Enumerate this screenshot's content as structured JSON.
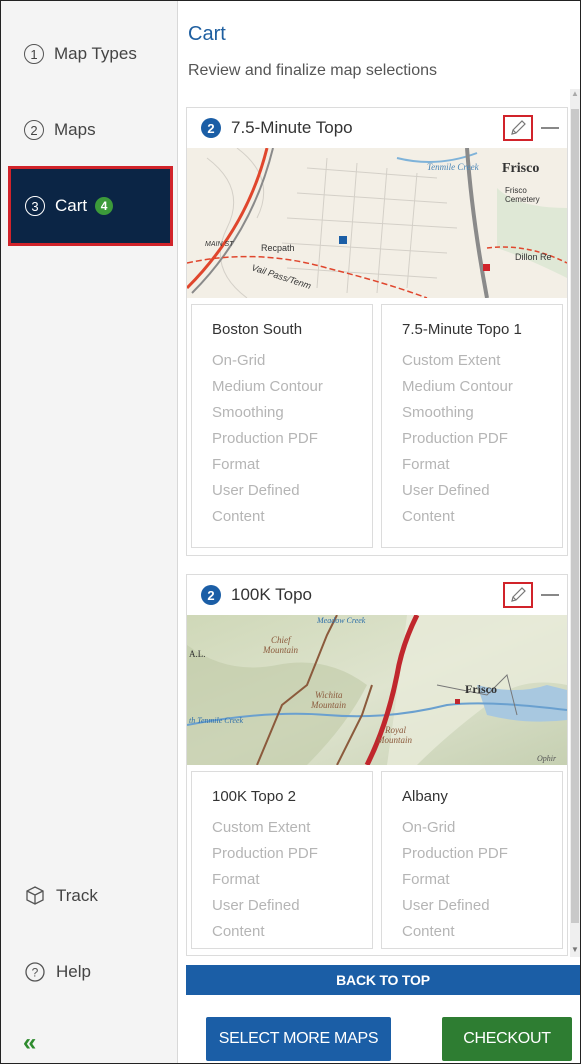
{
  "sidebar": {
    "steps": [
      {
        "num": "1",
        "label": "Map Types"
      },
      {
        "num": "2",
        "label": "Maps"
      },
      {
        "num": "3",
        "label": "Cart",
        "badge": "4"
      }
    ],
    "track_label": "Track",
    "help_label": "Help",
    "collapse_icon": "«"
  },
  "main": {
    "title": "Cart",
    "subtitle": "Review and finalize map selections",
    "cards": [
      {
        "qty": "2",
        "title": "7.5-Minute Topo",
        "map_labels": {
          "town": "Frisco",
          "creek": "Tenmile Creek",
          "cemetery_1": "Frisco",
          "cemetery_2": "Cemetery",
          "street": "MAIN ST",
          "recpath": "Recpath",
          "road": "Dillon Re",
          "pass": "Vail Pass/Tenm"
        },
        "variants": [
          {
            "name": "Boston South",
            "options": [
              "On-Grid",
              "Medium Contour",
              "Smoothing",
              "Production PDF",
              "Format",
              "User Defined",
              "Content"
            ]
          },
          {
            "name": "7.5-Minute Topo 1",
            "options": [
              "Custom Extent",
              "Medium Contour",
              "Smoothing",
              "Production PDF",
              "Format",
              "User Defined",
              "Content"
            ]
          }
        ]
      },
      {
        "qty": "2",
        "title": "100K Topo",
        "map_labels": {
          "town": "Frisco",
          "creek": "th Tenmile Creek",
          "chief_1": "Chief",
          "chief_2": "Mountain",
          "wichita_1": "Wichita",
          "wichita_2": "Mountain",
          "royal_1": "Royal",
          "royal_2": "Mountain",
          "meadow": "Meadow Creek",
          "ophir": "Ophir",
          "al": "A.L."
        },
        "variants": [
          {
            "name": "100K Topo 2",
            "options": [
              "Custom Extent",
              "Production PDF",
              "Format",
              "User Defined",
              "Content"
            ]
          },
          {
            "name": "Albany",
            "options": [
              "On-Grid",
              "Production PDF",
              "Format",
              "User Defined",
              "Content"
            ]
          }
        ]
      }
    ],
    "back_to_top": "BACK TO TOP",
    "select_more": "SELECT MORE MAPS",
    "checkout": "CHECKOUT"
  },
  "colors": {
    "accent_blue": "#1b5ea6",
    "nav_active": "#0b2545",
    "highlight_red": "#d1232a",
    "checkout_green": "#2e7d32",
    "badge_green": "#3c9a3a"
  }
}
